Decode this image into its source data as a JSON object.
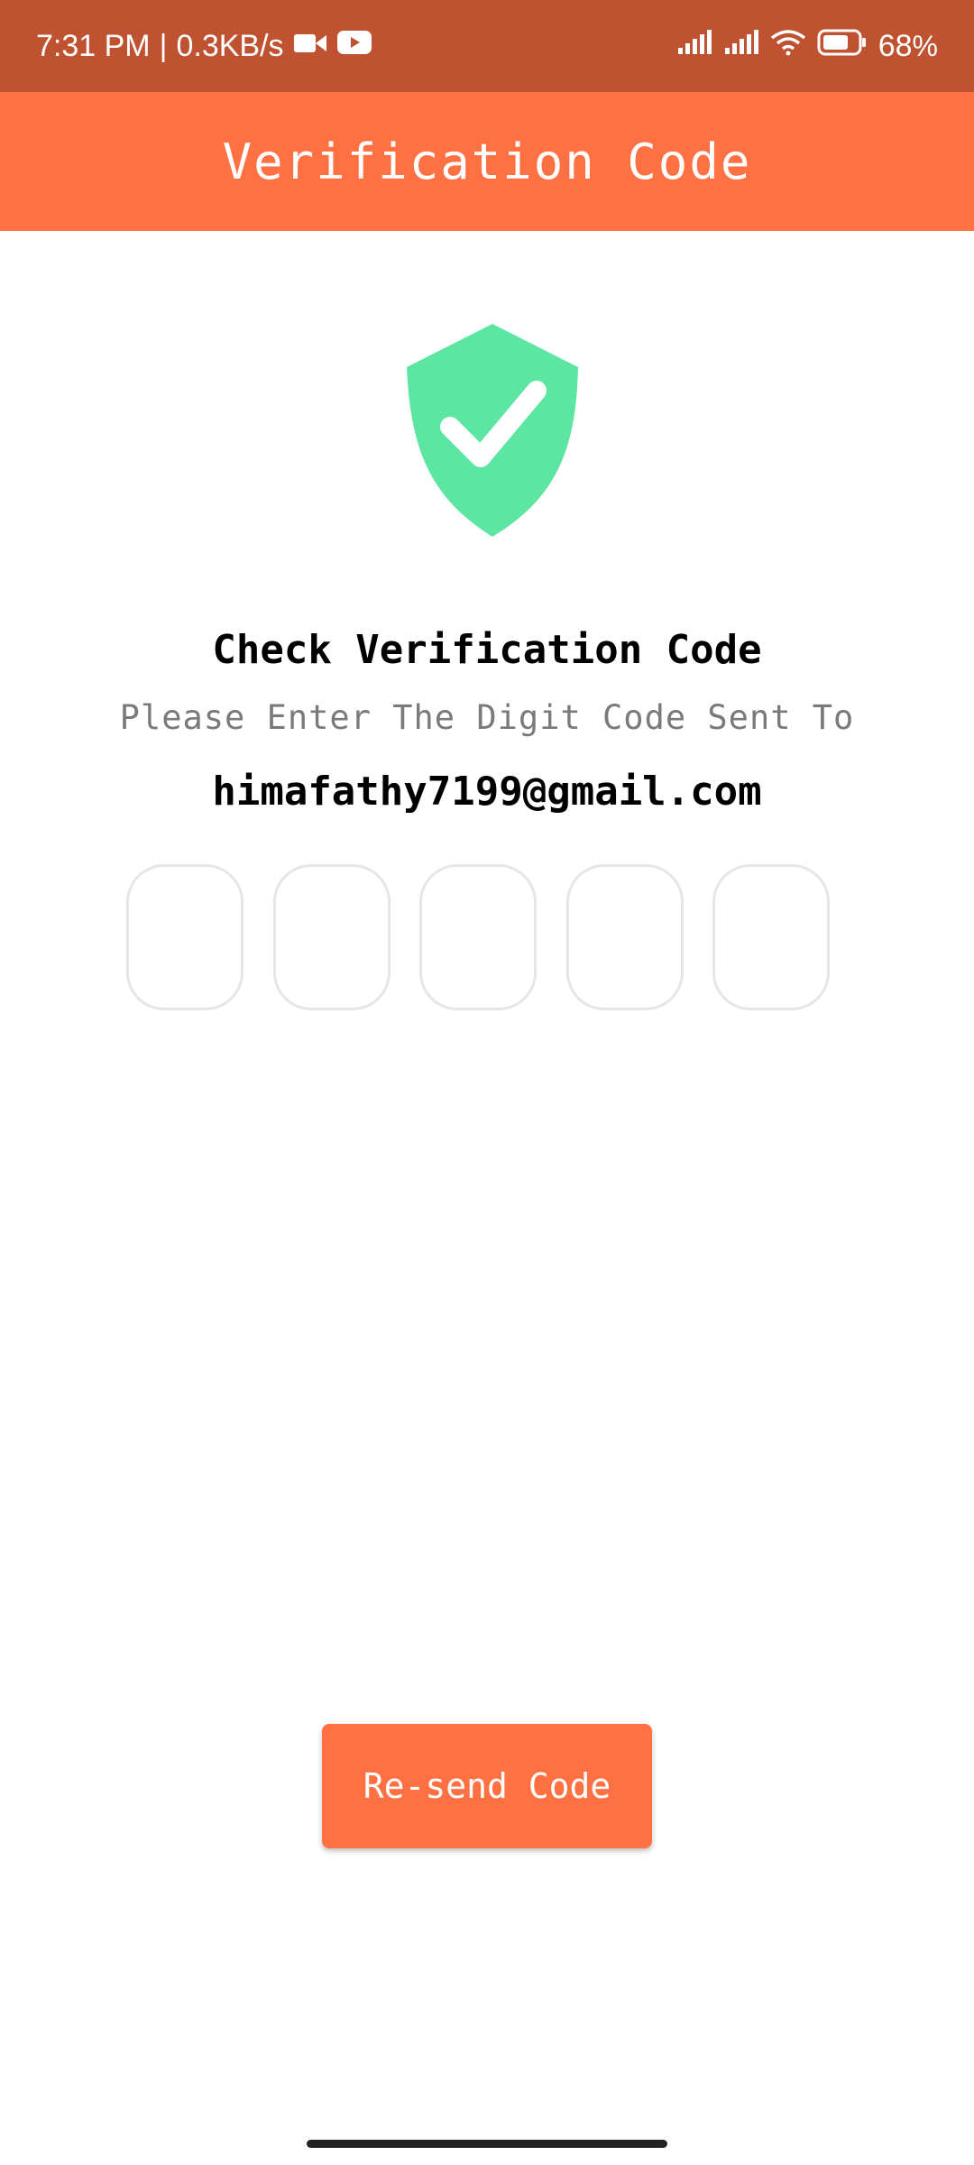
{
  "status_bar": {
    "time": "7:31 PM",
    "separator": "|",
    "speed": "0.3KB/s",
    "battery": "68",
    "battery_unit": "%",
    "icons": [
      "video-camera-icon",
      "youtube-icon",
      "signal-icon",
      "signal-icon",
      "wifi-icon",
      "battery-icon"
    ]
  },
  "app_bar": {
    "title": "Verification Code"
  },
  "content": {
    "heading": "Check Verification Code",
    "subtext": "Please Enter The Digit Code Sent To",
    "email": "himafathy7199@gmail.com",
    "code_digits": [
      "",
      "",
      "",
      "",
      ""
    ],
    "shield_icon": "shield-check-icon"
  },
  "actions": {
    "resend_label": "Re-send Code"
  },
  "colors": {
    "status_bar": "#bf5230",
    "accent": "#ff7043",
    "shield": "#5ce6a2",
    "subtext": "#7a7a7a",
    "box_border": "#e6e6e6"
  }
}
